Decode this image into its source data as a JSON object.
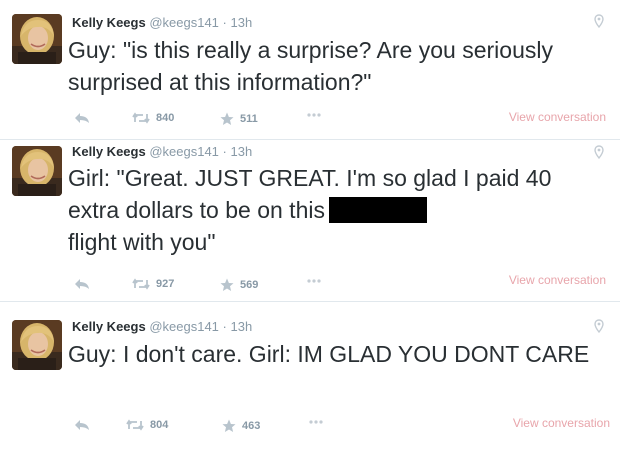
{
  "tweets": [
    {
      "name": "Kelly Keegs",
      "handle": "@keegs141",
      "separator": "·",
      "time": "13h",
      "text": "Guy: \"is this really a surprise? Are you seriously surprised at this information?\"",
      "retweets": "840",
      "favorites": "511",
      "view_conversation": "View conversation"
    },
    {
      "name": "Kelly Keegs",
      "handle": "@keegs141",
      "separator": "·",
      "time": "13h",
      "text_before_redaction": "Girl: \"Great. JUST GREAT. I'm so glad I paid 40 extra dollars to be on this",
      "text_after_redaction": "flight with you\"",
      "retweets": "927",
      "favorites": "569",
      "view_conversation": "View conversation"
    },
    {
      "name": "Kelly Keegs",
      "handle": "@keegs141",
      "separator": "·",
      "time": "13h",
      "text": "Guy: I don't care. Girl: IM GLAD YOU DONT CARE",
      "retweets": "804",
      "favorites": "463",
      "view_conversation": "View conversation"
    }
  ],
  "icons": {
    "reply": "reply-icon",
    "retweet": "retweet-icon",
    "favorite": "star-icon",
    "more": "more-icon",
    "location": "location-pin-icon"
  },
  "colors": {
    "text": "#292f33",
    "muted": "#8899a6",
    "view_conversation": "#e8a5ab",
    "divider": "#e1e8ed"
  }
}
